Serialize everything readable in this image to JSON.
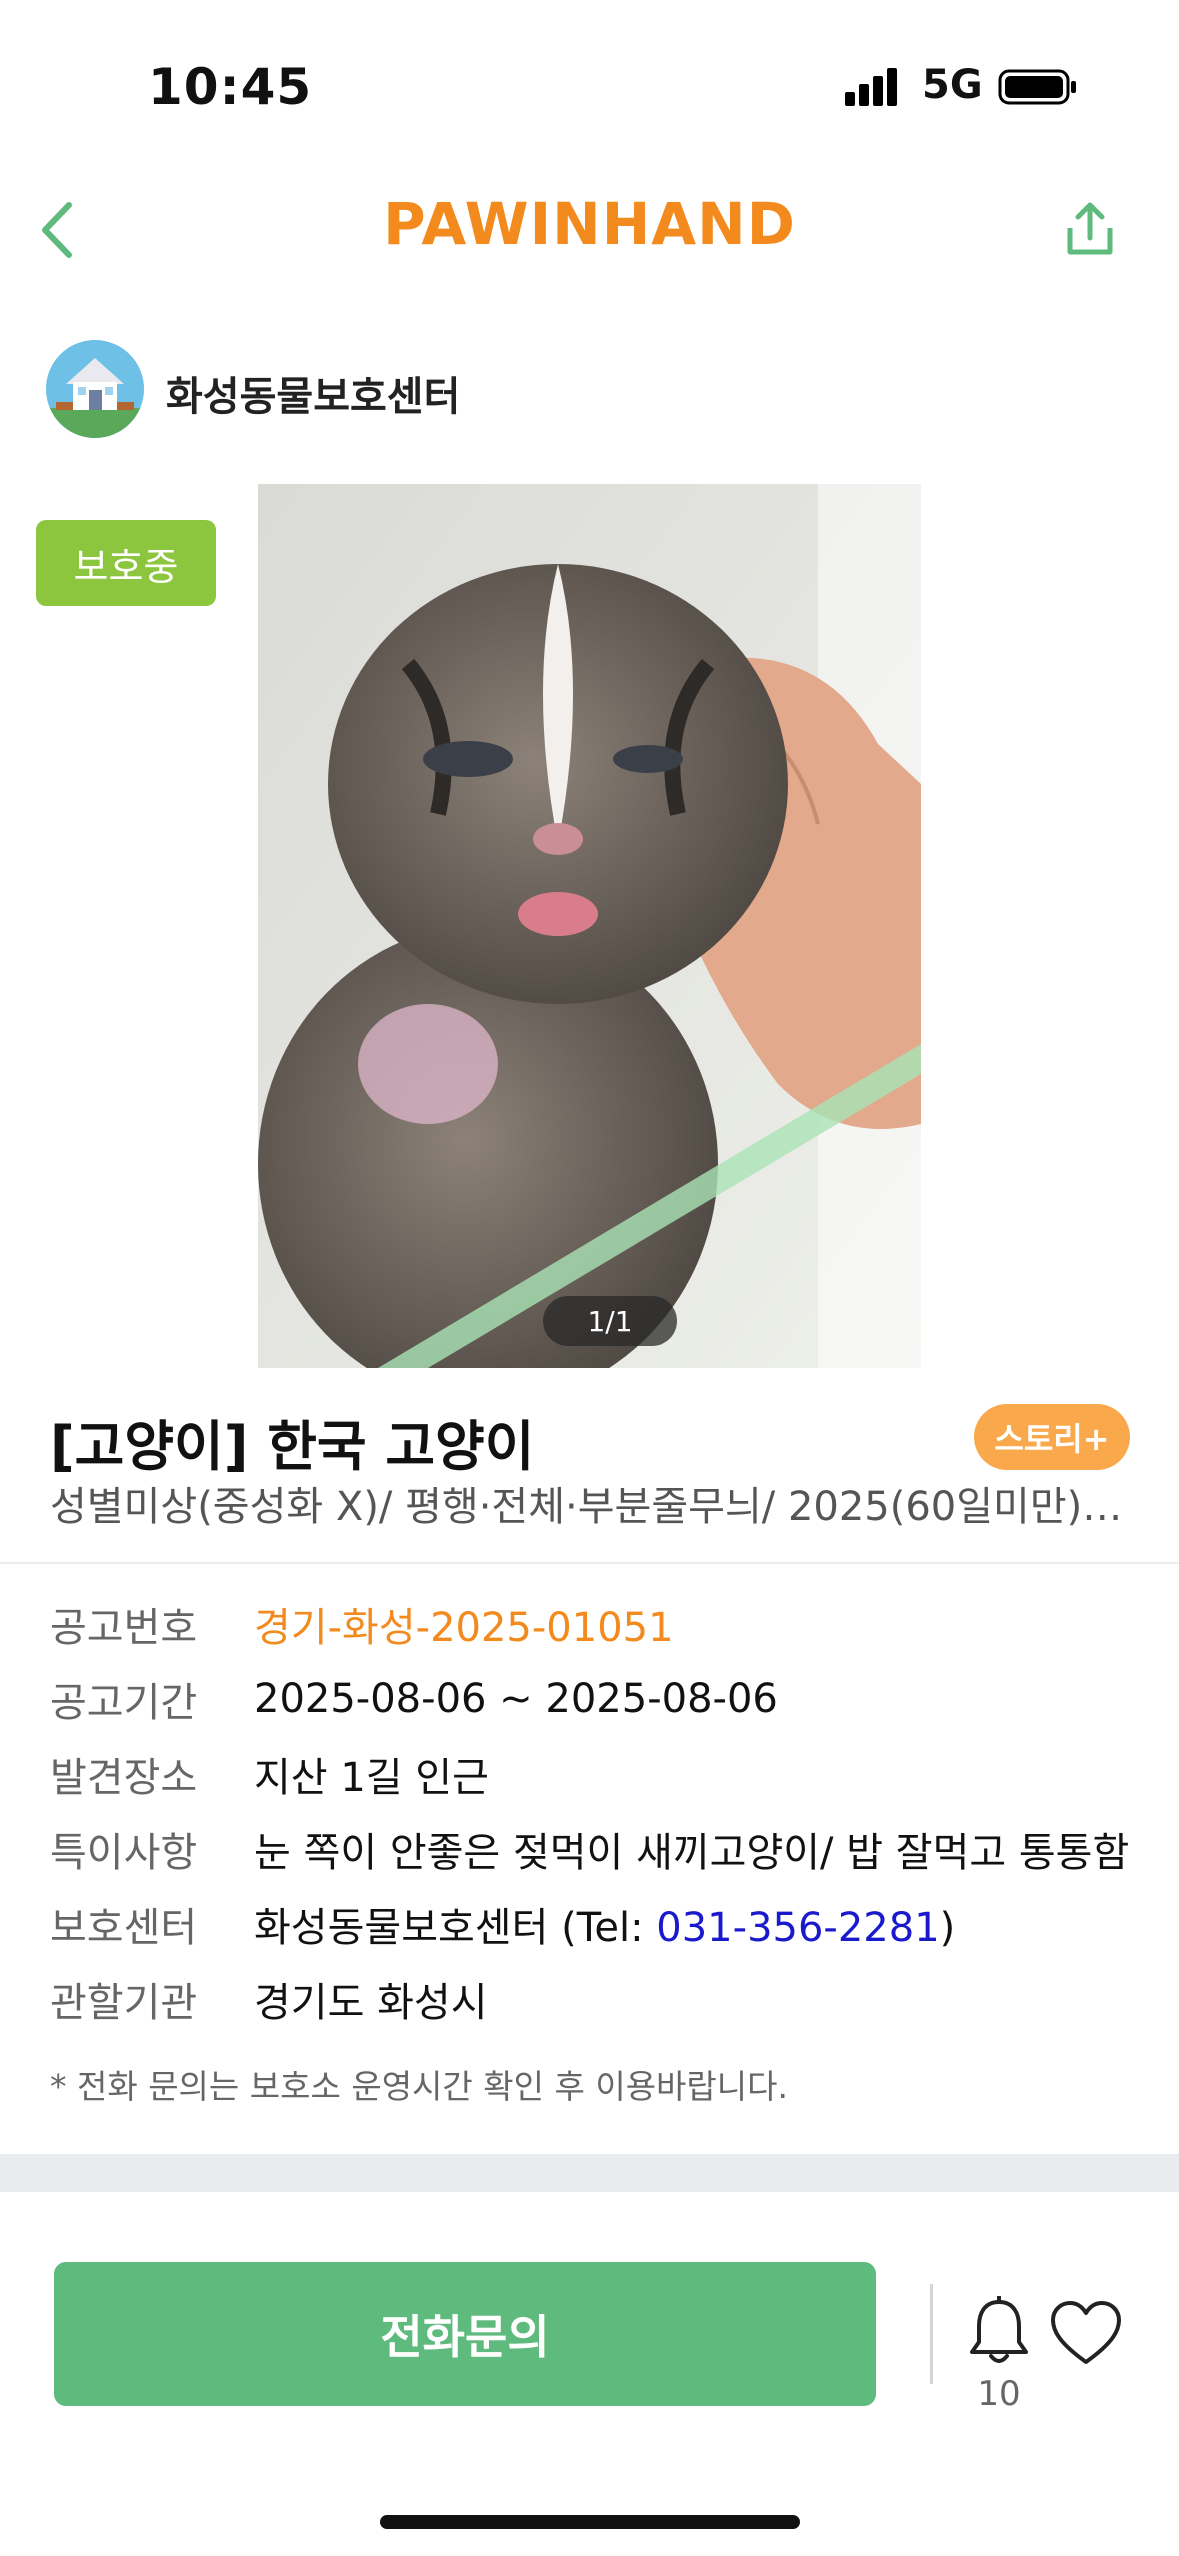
{
  "status_bar": {
    "time": "10:45",
    "network": "5G"
  },
  "header": {
    "brand": "PAWINHAND"
  },
  "shelter": {
    "name": "화성동물보호센터"
  },
  "photo": {
    "badge": "보호중",
    "counter": "1/1"
  },
  "animal": {
    "title": "[고양이] 한국 고양이",
    "story_button": "스토리+",
    "summary": "성별미상(중성화 X)/ 평행·전체·부분줄무늬/ 2025(60일미만)(…"
  },
  "info": {
    "notice_no_label": "공고번호",
    "notice_no": "경기-화성-2025-01051",
    "period_label": "공고기간",
    "period": "2025-08-06 ~ 2025-08-06",
    "location_label": "발견장소",
    "location": "지산 1길 인근",
    "notes_label": "특이사항",
    "notes": "눈 쪽이 안좋은 젖먹이 새끼고양이/ 밥 잘먹고 통통함",
    "center_label": "보호센터",
    "center_name": "화성동물보호센터",
    "tel_prefix": " (Tel: ",
    "tel": "031-356-2281",
    "tel_suffix": ")",
    "authority_label": "관할기관",
    "authority": "경기도 화성시"
  },
  "notice_text": "* 전화 문의는 보호소 운영시간 확인 후 이용바랍니다.",
  "bottom_bar": {
    "call_label": "전화문의",
    "alarm_count": "10"
  },
  "colors": {
    "brand": "#f28a1e",
    "badge": "#8cc63f",
    "call": "#5fba7d",
    "story": "#f9a94b",
    "link": "#1a1acc"
  }
}
